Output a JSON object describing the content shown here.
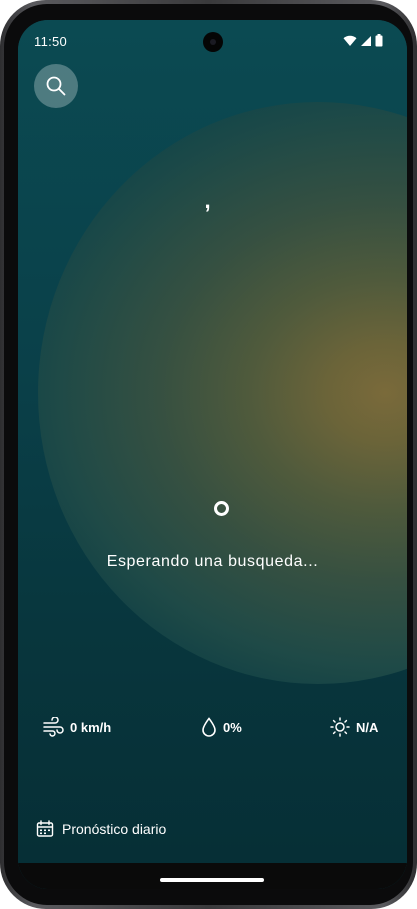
{
  "status_bar": {
    "time": "11:50",
    "icons": [
      "wifi-icon",
      "signal-icon",
      "battery-icon"
    ]
  },
  "header": {
    "search_icon": "search-icon"
  },
  "location": {
    "text": ","
  },
  "loading": {
    "message": "Esperando una busqueda..."
  },
  "metrics": {
    "wind": {
      "icon": "wind-icon",
      "value": "0 km/h"
    },
    "humidity": {
      "icon": "droplet-icon",
      "value": "0%"
    },
    "uv": {
      "icon": "sun-icon",
      "value": "N/A"
    }
  },
  "forecast": {
    "icon": "calendar-icon",
    "label": "Pronóstico diario"
  },
  "colors": {
    "background_teal": "#0a4049",
    "glow_gold": "#7a6a3a",
    "text": "#ffffff"
  }
}
